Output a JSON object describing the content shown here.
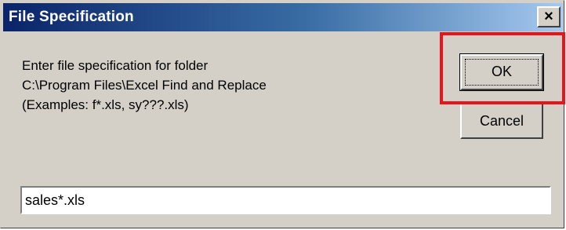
{
  "window": {
    "title": "File Specification",
    "close_glyph": "×"
  },
  "message": {
    "line1": "Enter file specification for folder",
    "line2": "C:\\Program Files\\Excel Find and Replace",
    "line3": "(Examples: f*.xls, sy???.xls)"
  },
  "buttons": {
    "ok_label": "OK",
    "cancel_label": "Cancel"
  },
  "filespec_input": {
    "value": "sales*.xls"
  },
  "colors": {
    "title_bar_start": "#0a246a",
    "title_bar_end": "#a6caf0",
    "dialog_face": "#d4d0c8",
    "highlight": "#e8141a"
  },
  "icons": {
    "close": "close-icon"
  }
}
